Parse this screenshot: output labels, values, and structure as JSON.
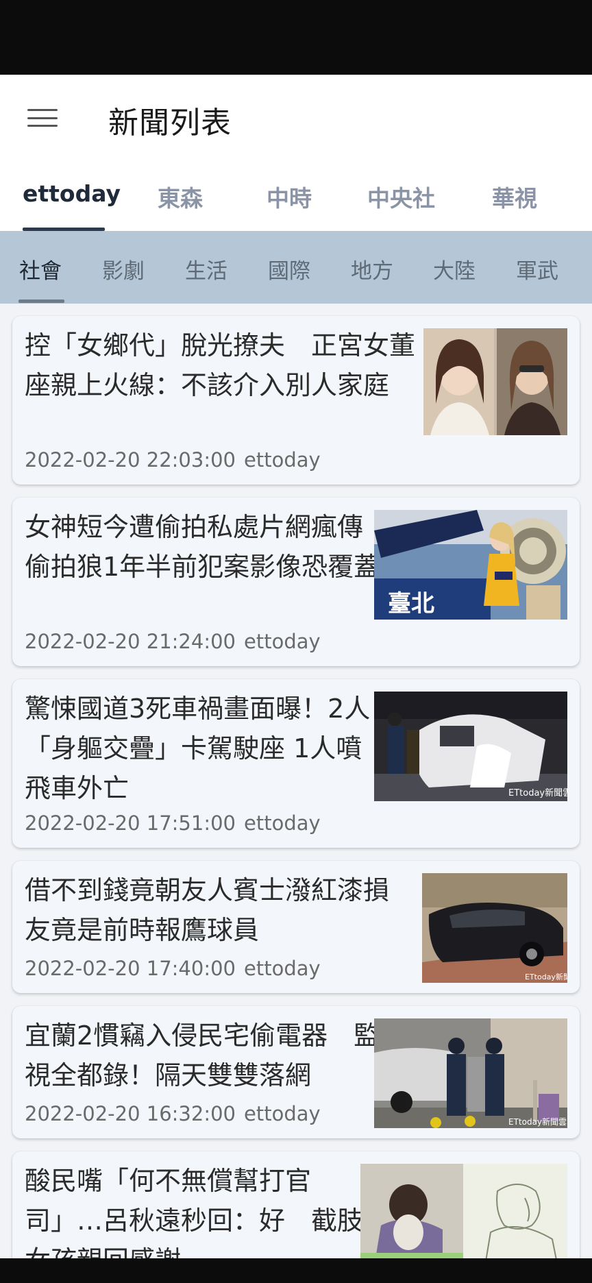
{
  "app_bar": {
    "title": "新聞列表",
    "menu_icon": "hamburger-menu-icon"
  },
  "source_tabs": [
    "ettoday",
    "東森",
    "中時",
    "中央社",
    "華視"
  ],
  "source_active": "ettoday",
  "category_tabs": [
    "社會",
    "影劇",
    "生活",
    "國際",
    "地方",
    "大陸",
    "軍武"
  ],
  "category_active": "社會",
  "colors": {
    "status_bar": "#0c0c0c",
    "category_bar": "#b5c7d6",
    "card_bg": "#f3f7fb",
    "indicator": "#2d3a4e"
  },
  "articles": [
    {
      "title": "控「女鄉代」脫光撩夫　正宮女董座親上火線：不該介入別人家庭",
      "date": "2022-02-20 22:03:00",
      "source": "ettoday",
      "image": "two-women-selfie-photo"
    },
    {
      "title": "女神短今遭偷拍私處片網瘋傳　偷拍狼1年半前犯案影像恐覆蓋",
      "date": "2022-02-20 21:24:00",
      "source": "ettoday",
      "image": "cheerleader-photo"
    },
    {
      "title": "驚悚國道3死車禍畫面曝！2人「身軀交疊」卡駕駛座 1人噴飛車外亡",
      "date": "2022-02-20 17:51:00",
      "source": "ettoday",
      "image": "car-crash-night-photo"
    },
    {
      "title": "借不到錢竟朝友人賓士潑紅漆損友竟是前時報鷹球員",
      "date": "2022-02-20 17:40:00",
      "source": "ettoday",
      "image": "painted-car-photo"
    },
    {
      "title": "宜蘭2慣竊入侵民宅偷電器　監視全都錄！隔天雙雙落網",
      "date": "2022-02-20 16:32:00",
      "source": "ettoday",
      "image": "police-arrest-photo"
    },
    {
      "title": "酸民嘴「何不無償幫打官司」…呂秋遠秒回：好　截肢女孩親回感謝",
      "date": "",
      "source": "",
      "image": "hospital-girl-sketch-photo"
    }
  ]
}
